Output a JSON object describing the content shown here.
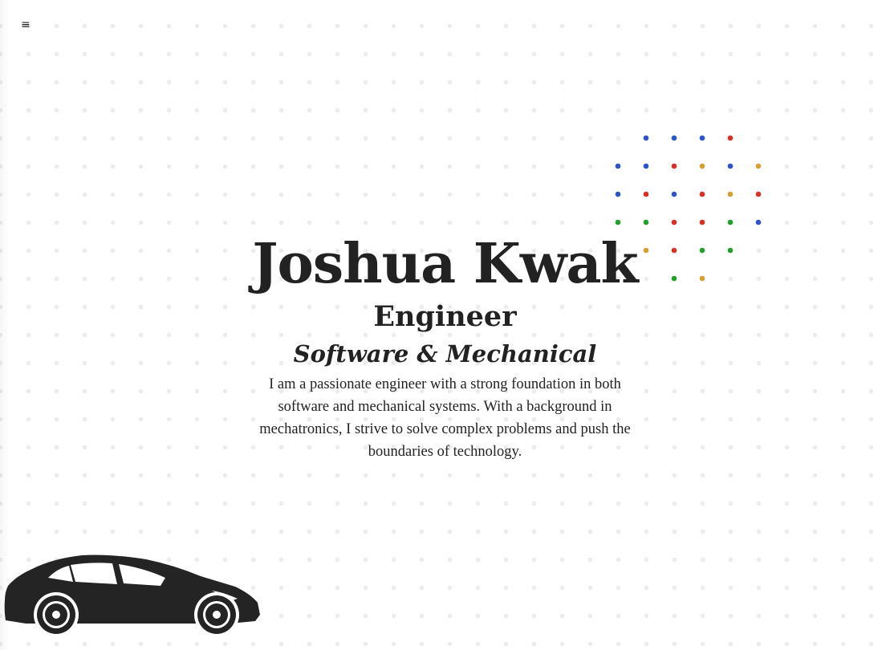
{
  "nav": {
    "menu_icon": "hamburger-menu-icon",
    "menu_glyph": "≡"
  },
  "hero": {
    "name": "Joshua Kwak",
    "role": "Engineer",
    "specialty": "Software & Mechanical",
    "bio": "I am a passionate engineer with a strong foundation in both software and mechanical systems. With a background in mechatronics, I strive to solve complex problems and push the boundaries of technology."
  },
  "decoration": {
    "background": "dot-grid-pattern",
    "car": "car-silhouette-icon",
    "accent_colors": {
      "blue": "#2b55c8",
      "red": "#d93025",
      "gold": "#d4a033",
      "green": "#1fa02a"
    }
  }
}
